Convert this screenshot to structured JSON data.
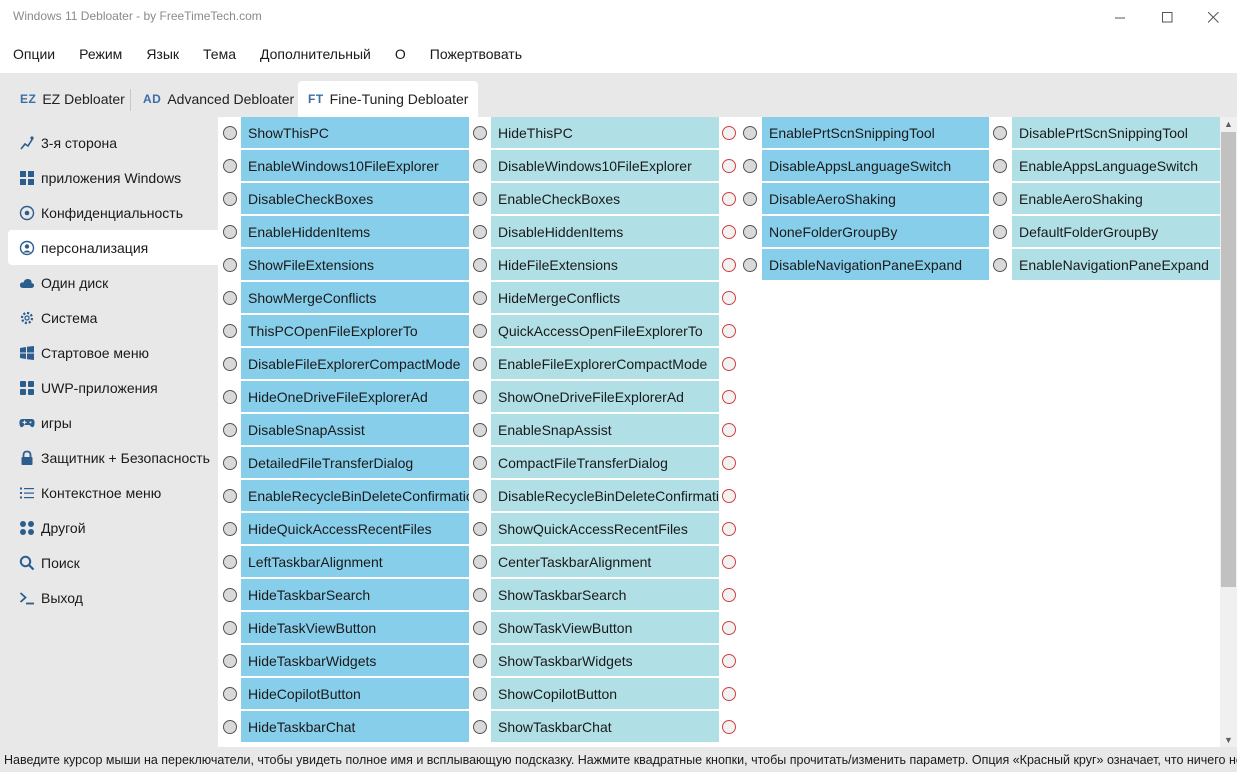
{
  "window": {
    "title": "Windows 11 Debloater - by FreeTimeTech.com",
    "minimize_icon": "minimize-icon",
    "maximize_icon": "maximize-icon",
    "close_icon": "close-icon"
  },
  "menu": [
    "Опции",
    "Режим",
    "Язык",
    "Тема",
    "Дополнительный",
    "О",
    "Пожертвовать"
  ],
  "tabs": [
    {
      "abbr": "EZ",
      "label": "EZ Debloater"
    },
    {
      "abbr": "AD",
      "label": "Advanced Debloater"
    },
    {
      "abbr": "FT",
      "label": "Fine-Tuning Debloater"
    }
  ],
  "sidebar": [
    {
      "icon": "third-party-icon",
      "label": "3-я сторона"
    },
    {
      "icon": "windows-apps-icon",
      "label": "приложения Windows"
    },
    {
      "icon": "privacy-eye-icon",
      "label": "Конфиденциальность"
    },
    {
      "icon": "user-circle-icon",
      "label": "персонализация"
    },
    {
      "icon": "cloud-icon",
      "label": "Один диск"
    },
    {
      "icon": "gear-icon",
      "label": "Система"
    },
    {
      "icon": "windows-logo-icon",
      "label": "Стартовое меню"
    },
    {
      "icon": "uwp-grid-icon",
      "label": "UWP-приложения"
    },
    {
      "icon": "gamepad-icon",
      "label": "игры"
    },
    {
      "icon": "lock-icon",
      "label": "Защитник + Безопасность"
    },
    {
      "icon": "list-icon",
      "label": "Контекстное меню"
    },
    {
      "icon": "dots-grid-icon",
      "label": "Другой"
    },
    {
      "icon": "search-icon",
      "label": "Поиск"
    },
    {
      "icon": "terminal-icon",
      "label": "Выход"
    }
  ],
  "sidebar_active_index": 3,
  "group1": [
    {
      "on": "ShowThisPC",
      "off": "HideThisPC"
    },
    {
      "on": "EnableWindows10FileExplorer",
      "off": "DisableWindows10FileExplorer"
    },
    {
      "on": "DisableCheckBoxes",
      "off": "EnableCheckBoxes"
    },
    {
      "on": "EnableHiddenItems",
      "off": "DisableHiddenItems"
    },
    {
      "on": "ShowFileExtensions",
      "off": "HideFileExtensions"
    },
    {
      "on": "ShowMergeConflicts",
      "off": "HideMergeConflicts"
    },
    {
      "on": "ThisPCOpenFileExplorerTo",
      "off": "QuickAccessOpenFileExplorerTo"
    },
    {
      "on": "DisableFileExplorerCompactMode",
      "off": "EnableFileExplorerCompactMode"
    },
    {
      "on": "HideOneDriveFileExplorerAd",
      "off": "ShowOneDriveFileExplorerAd"
    },
    {
      "on": "DisableSnapAssist",
      "off": "EnableSnapAssist"
    },
    {
      "on": "DetailedFileTransferDialog",
      "off": "CompactFileTransferDialog"
    },
    {
      "on": "EnableRecycleBinDeleteConfirmation",
      "off": "DisableRecycleBinDeleteConfirmation"
    },
    {
      "on": "HideQuickAccessRecentFiles",
      "off": "ShowQuickAccessRecentFiles"
    },
    {
      "on": "LeftTaskbarAlignment",
      "off": "CenterTaskbarAlignment"
    },
    {
      "on": "HideTaskbarSearch",
      "off": "ShowTaskbarSearch"
    },
    {
      "on": "HideTaskViewButton",
      "off": "ShowTaskViewButton"
    },
    {
      "on": "HideTaskbarWidgets",
      "off": "ShowTaskbarWidgets"
    },
    {
      "on": "HideCopilotButton",
      "off": "ShowCopilotButton"
    },
    {
      "on": "HideTaskbarChat",
      "off": "ShowTaskbarChat"
    }
  ],
  "group2": [
    {
      "on": "EnablePrtScnSnippingTool",
      "off": "DisablePrtScnSnippingTool"
    },
    {
      "on": "DisableAppsLanguageSwitch",
      "off": "EnableAppsLanguageSwitch"
    },
    {
      "on": "DisableAeroShaking",
      "off": "EnableAeroShaking"
    },
    {
      "on": "NoneFolderGroupBy",
      "off": "DefaultFolderGroupBy"
    },
    {
      "on": "DisableNavigationPaneExpand",
      "off": "EnableNavigationPaneExpand"
    }
  ],
  "status_text": "Наведите курсор мыши на переключатели, чтобы увидеть полное имя и всплывающую подсказку. Нажмите квадратные кнопки, чтобы прочитать/изменить параметр. Опция «Красный круг» означает, что ничего не выбрано.",
  "colors": {
    "on_button": "#87ceeb",
    "off_button": "#b0e0e6",
    "panel_bg": "#e8e8e8"
  }
}
